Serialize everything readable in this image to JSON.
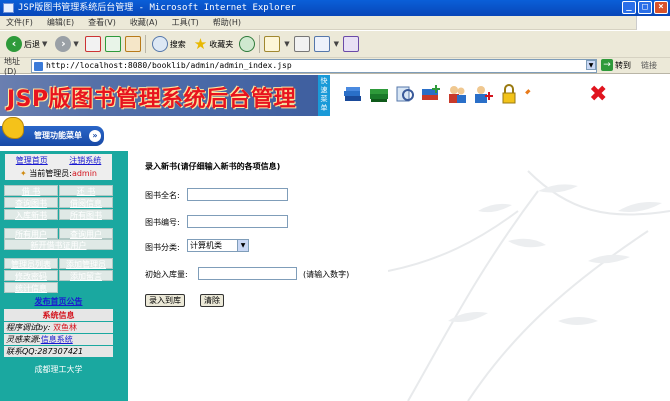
{
  "window": {
    "title": "JSP版图书管理系统后台管理 - Microsoft Internet Explorer",
    "buttons": [
      "_",
      "□",
      "×"
    ]
  },
  "menubar": [
    "文件(F)",
    "编辑(E)",
    "查看(V)",
    "收藏(A)",
    "工具(T)",
    "帮助(H)"
  ],
  "toolbar": {
    "back": "后退",
    "search": "搜索",
    "favorites": "收藏夹"
  },
  "address": {
    "label": "地址(D)",
    "url": "http://localhost:8080/booklib/admin/admin_index.jsp",
    "go": "转到",
    "links": "链接"
  },
  "banner": {
    "title": "JSP版图书管理系统后台管理",
    "badge": "快速菜单"
  },
  "menu_head": {
    "label": "管理功能菜单"
  },
  "sidebar": {
    "home": "管理首页",
    "logout": "注销系统",
    "current_admin_label": "当前管理员:",
    "current_admin": "admin",
    "group1": [
      "借 书",
      "还 书",
      "查询图书",
      "借阅信息",
      "入库新书",
      "所有图书"
    ],
    "group2": [
      "所有用户",
      "查询用户",
      "新开借书证用户"
    ],
    "group3": [
      "管理员列表",
      "添加管理员",
      "修改密码",
      "添加留言",
      "统计信息"
    ],
    "announce": "发布首页公告",
    "sysinfo_title": "系统信息",
    "debug_label": "程序调试by: ",
    "debug_name": "双鱼林",
    "source_label": "灵感来源:",
    "source_name": "信息系统",
    "qq": "联系QQ:287307421",
    "school": "成都理工大学"
  },
  "form": {
    "title": "录入新书(请仔细输入新书的各项信息)",
    "name_label": "图书全名:",
    "id_label": "图书编号:",
    "category_label": "图书分类:",
    "category_value": "计算机类",
    "stock_label": "初始入库量:",
    "stock_hint": "(请输入数字)",
    "submit": "录入到库",
    "clear": "清除"
  }
}
